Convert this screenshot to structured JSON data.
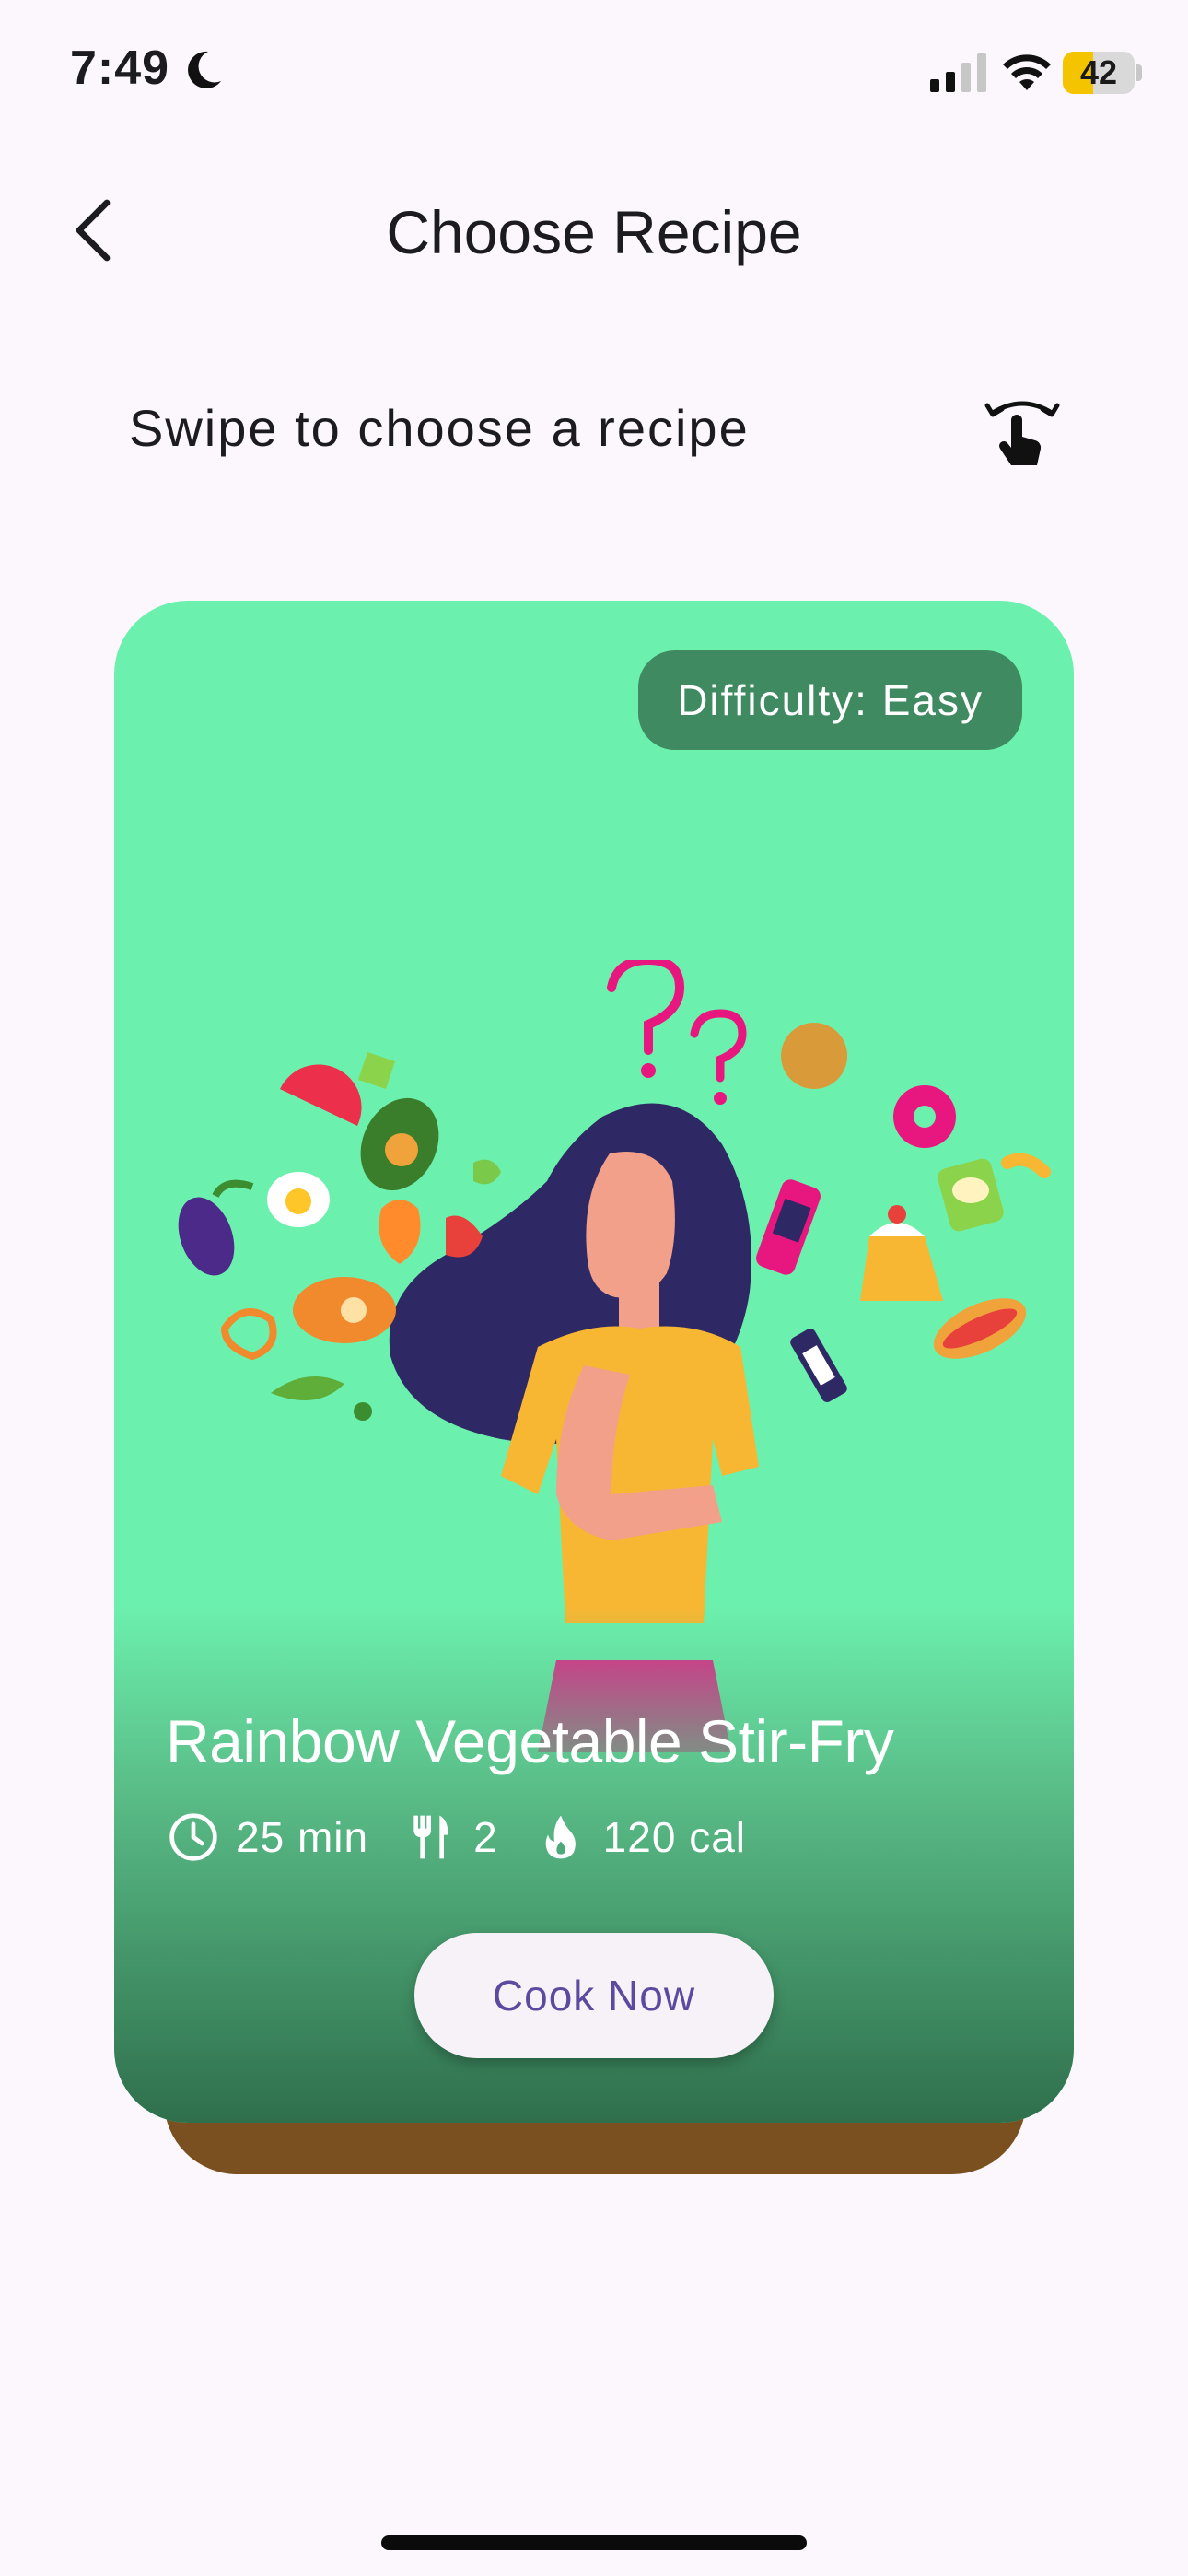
{
  "status_bar": {
    "time": "7:49",
    "battery_level": "42",
    "battery_fraction": 0.42
  },
  "header": {
    "title": "Choose Recipe"
  },
  "instruction": {
    "text": "Swipe to choose a recipe"
  },
  "recipe_card": {
    "difficulty": "Difficulty: Easy",
    "title": "Rainbow Vegetable Stir-Fry",
    "time": "25 min",
    "servings": "2",
    "calories": "120 cal",
    "cook_button": "Cook Now"
  },
  "colors": {
    "card_background": "#6cf0ad",
    "badge_background": "#3f8a60",
    "back_card": "#7a5021",
    "button_text": "#5b4aa0",
    "page_background": "#fbf7fc"
  },
  "icons": {
    "back": "chevron-left-icon",
    "swipe": "swipe-gesture-icon",
    "time": "clock-icon",
    "servings": "utensils-icon",
    "calories": "flame-icon"
  }
}
